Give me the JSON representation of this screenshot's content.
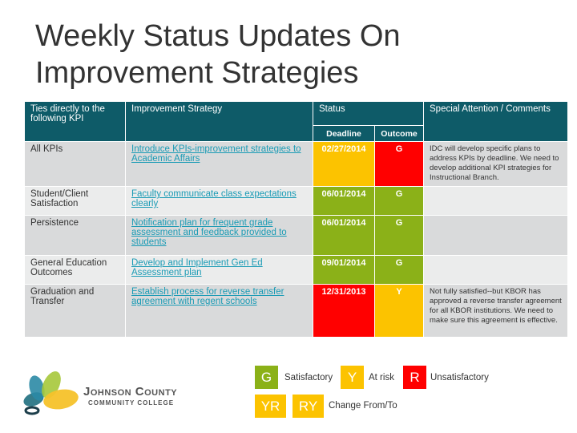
{
  "title": "Weekly Status Updates On Improvement Strategies",
  "table": {
    "headers": {
      "kpi": "Ties directly to the following KPI",
      "strategy": "Improvement Strategy",
      "status": "Status",
      "deadline": "Deadline",
      "outcome": "Outcome",
      "comments": "Special Attention / Comments"
    },
    "rows": [
      {
        "kpi": "All KPIs",
        "strategy": "Introduce KPIs-improvement strategies to Academic Affairs",
        "deadline": "02/27/2014",
        "deadline_color": "yellow",
        "outcome": "G",
        "outcome_color": "red",
        "comment": "IDC will develop specific plans to address KPIs by deadline.  We need to develop additional KPI strategies for Instructional Branch."
      },
      {
        "kpi": "Student/Client Satisfaction",
        "strategy": "Faculty communicate class expectations clearly",
        "deadline": "06/01/2014",
        "deadline_color": "green",
        "outcome": "G",
        "outcome_color": "green",
        "comment": ""
      },
      {
        "kpi": "Persistence",
        "strategy": "Notification plan for frequent grade assessment and feedback provided to students",
        "deadline": "06/01/2014",
        "deadline_color": "green",
        "outcome": "G",
        "outcome_color": "green",
        "comment": ""
      },
      {
        "kpi": "General Education Outcomes",
        "strategy": "Develop and Implement Gen Ed Assessment plan",
        "deadline": "09/01/2014",
        "deadline_color": "green",
        "outcome": "G",
        "outcome_color": "green",
        "comment": ""
      },
      {
        "kpi": "Graduation and Transfer",
        "strategy": "Establish process for reverse transfer agreement with regent schools",
        "deadline": "12/31/2013",
        "deadline_color": "red",
        "outcome": "Y",
        "outcome_color": "yellow",
        "comment": "Not fully satisfied--but KBOR has approved a reverse transfer agreement for all KBOR institutions.  We need to make sure this agreement is effective."
      }
    ]
  },
  "legend": {
    "g": {
      "code": "G",
      "label": "Satisfactory"
    },
    "y": {
      "code": "Y",
      "label": "At risk"
    },
    "r": {
      "code": "R",
      "label": "Unsatisfactory"
    },
    "yr": {
      "code": "YR"
    },
    "ry": {
      "code": "RY"
    },
    "change_label": "Change From/To"
  },
  "logo": {
    "line1": "Johnson County",
    "line2": "COMMUNITY COLLEGE"
  },
  "colors": {
    "header": "#0e5b68",
    "green": "#8bb118",
    "yellow": "#fcc300",
    "red": "#ff0000",
    "link": "#1a9bb5"
  }
}
